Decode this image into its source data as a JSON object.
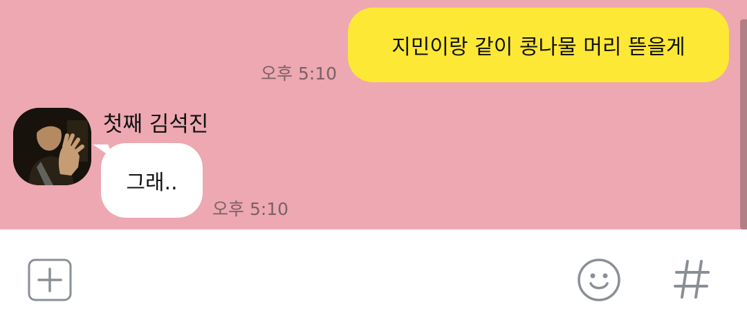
{
  "messages": {
    "outgoing": {
      "text": "지민이랑 같이 콩나물 머리 뜯을게",
      "time": "오후 5:10"
    },
    "incoming": {
      "sender": "첫째 김석진",
      "text": "그래..",
      "time": "오후 5:10"
    }
  },
  "colors": {
    "chat_background": "#eda8b1",
    "outgoing_bubble": "#fde835",
    "incoming_bubble": "#ffffff",
    "icon_gray": "#8a8f96"
  },
  "input_bar": {
    "icons": [
      "plus-icon",
      "emoji-icon",
      "hashtag-icon"
    ]
  }
}
